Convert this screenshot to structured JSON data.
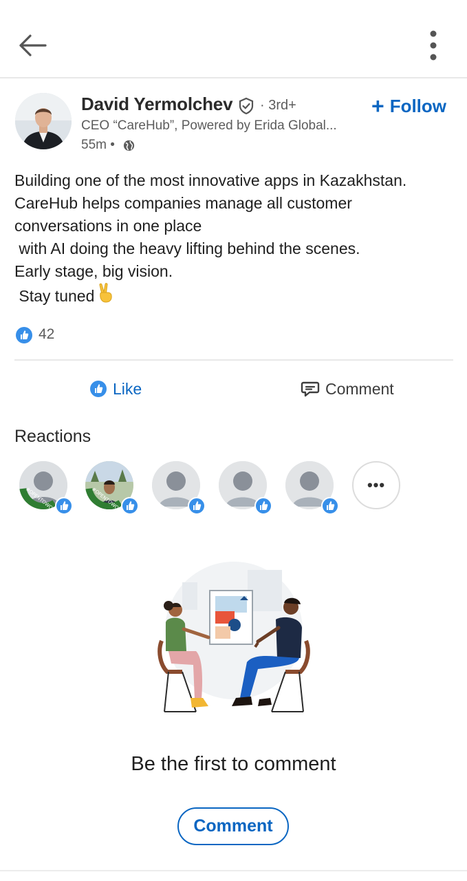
{
  "header": {
    "back_icon": "arrow-left-icon",
    "more_icon": "vertical-dots-icon"
  },
  "post": {
    "author": {
      "name": "David Yermolchev",
      "degree": "· 3rd+",
      "headline": "CEO “CareHub”, Powered by Erida Global...",
      "time": "55m •",
      "verified_icon": "verified-shield-icon"
    },
    "follow_label": "Follow",
    "body_lines": [
      "Building one of the most innovative apps in Kazakhstan.",
      "CareHub helps companies manage all customer",
      "conversations in one place",
      " with AI doing the heavy lifting behind the scenes.",
      "Early stage, big vision.",
      " Stay tuned"
    ],
    "reaction_count": "42"
  },
  "actions": {
    "like_label": "Like",
    "comment_label": "Comment"
  },
  "reactions": {
    "title": "Reactions",
    "more_label": "•••"
  },
  "empty_state": {
    "title": "Be the first to comment",
    "button_label": "Comment"
  },
  "colors": {
    "accent": "#0a66c2",
    "text": "#1f1f1f",
    "muted": "#5c5c5c",
    "opentowork": "#2f7d32"
  }
}
